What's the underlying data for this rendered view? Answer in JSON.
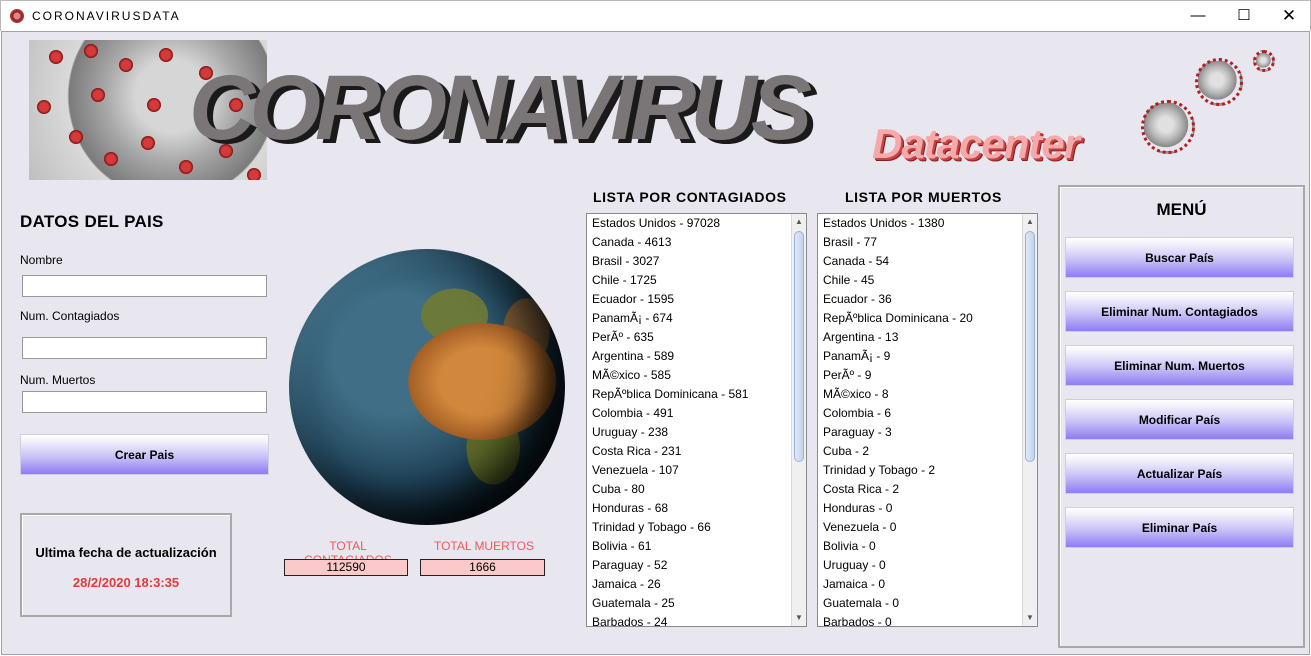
{
  "window": {
    "title": "CORONAVIRUSDATA",
    "min_glyph": "—",
    "max_glyph": "☐",
    "close_glyph": "✕"
  },
  "banner": {
    "title": "CORONAVIRUS",
    "subtitle": "Datacenter"
  },
  "country_form": {
    "heading": "DATOS DEL PAIS",
    "name_label": "Nombre",
    "name_value": "",
    "infected_label": "Num. Contagiados",
    "infected_value": "",
    "deaths_label": "Num. Muertos",
    "deaths_value": "",
    "create_button": "Crear Pais"
  },
  "last_update": {
    "label": "Ultima fecha de actualización",
    "value": "28/2/2020   18:3:35"
  },
  "totals": {
    "infected_label": "TOTAL CONTAGIADOS",
    "infected_value": "112590",
    "deaths_label": "TOTAL MUERTOS",
    "deaths_value": "1666"
  },
  "infected_list": {
    "heading": "LISTA POR CONTAGIADOS",
    "items": [
      "Estados Unidos  - 97028",
      "Canada  - 4613",
      "Brasil  - 3027",
      "Chile  - 1725",
      "Ecuador  - 1595",
      "PanamÃ¡  - 674",
      "PerÃº  - 635",
      "Argentina  - 589",
      "MÃ©xico  - 585",
      "RepÃºblica Dominicana  - 581",
      "Colombia  - 491",
      "Uruguay  - 238",
      "Costa Rica  - 231",
      "Venezuela  - 107",
      "Cuba  - 80",
      "Honduras  - 68",
      "Trinidad y Tobago  - 66",
      "Bolivia  - 61",
      "Paraguay  - 52",
      "Jamaica  - 26",
      "Guatemala  - 25",
      "Barbados  - 24"
    ]
  },
  "deaths_list": {
    "heading": "LISTA POR MUERTOS",
    "items": [
      "Estados Unidos  - 1380",
      "Brasil  - 77",
      "Canada  - 54",
      "Chile  - 45",
      "Ecuador  - 36",
      "RepÃºblica Dominicana  - 20",
      "Argentina  - 13",
      "PanamÃ¡  - 9",
      "PerÃº  - 9",
      "MÃ©xico  - 8",
      "Colombia  - 6",
      "Paraguay  - 3",
      "Cuba  - 2",
      "Trinidad y Tobago  - 2",
      "Costa Rica  - 2",
      "Honduras  - 0",
      "Venezuela  - 0",
      "Bolivia  - 0",
      "Uruguay  - 0",
      "Jamaica  - 0",
      "Guatemala  - 0",
      "Barbados  - 0"
    ]
  },
  "menu": {
    "heading": "MENÚ",
    "buttons": [
      "Buscar País",
      "Eliminar Num. Contagiados",
      "Eliminar Num. Muertos",
      "Modificar País",
      "Actualizar País",
      "Eliminar País"
    ]
  },
  "colors": {
    "accent_red": "#e23b3b",
    "total_box_fill": "#fbc9c9",
    "button_gradient_bottom": "#8e7cf3"
  }
}
